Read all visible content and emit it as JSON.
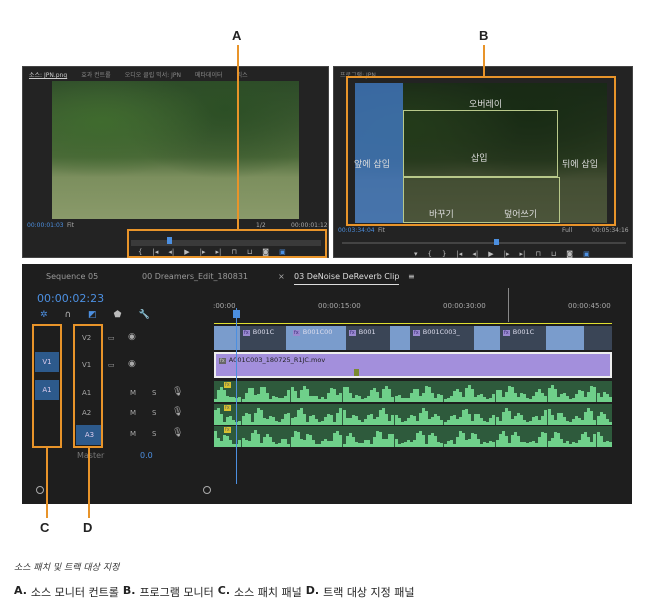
{
  "callouts": {
    "a": "A",
    "b": "B",
    "c": "C",
    "d": "D"
  },
  "source_monitor": {
    "tabs": [
      "소스: JPN.png",
      "효과 컨트롤",
      "오디오 클립 믹서: JPN",
      "메타데이터",
      "믹스"
    ],
    "timecode_left": "00:00:01:03",
    "fit": "Fit",
    "resolution": "1/2",
    "timecode_right": "00:00:01:12"
  },
  "program_monitor": {
    "tab": "프로그램: JPN",
    "overlays": {
      "overlay": "오버레이",
      "insert": "삽입",
      "insert_before": "앞에 삽입",
      "insert_after": "뒤에 삽입",
      "replace": "바꾸기",
      "overwrite": "덮어쓰기"
    },
    "timecode_left": "00:03:34:04",
    "fit": "Fit",
    "resolution": "Full",
    "timecode_right": "00:05:34:16"
  },
  "timeline": {
    "tabs": [
      "Sequence 05",
      "00 Dreamers_Edit_180831",
      "03 DeNoise DeReverb Clip"
    ],
    "active_tab_close": "×",
    "menu_icon": "≡",
    "timecode": "00:00:02:23",
    "ruler": [
      ":00:00",
      "00:00:15:00",
      "00:00:30:00",
      "00:00:45:00"
    ],
    "source_patch": {
      "v": "V1",
      "a": "A1"
    },
    "tracks": [
      {
        "label": "V2",
        "type": "video"
      },
      {
        "label": "V1",
        "type": "video"
      },
      {
        "label": "A1",
        "type": "audio",
        "m": "M",
        "s": "S"
      },
      {
        "label": "A2",
        "type": "audio",
        "m": "M",
        "s": "S"
      },
      {
        "label": "A3",
        "type": "audio",
        "m": "M",
        "s": "S"
      }
    ],
    "master": {
      "label": "Master",
      "value": "0.0"
    },
    "fx": "fx",
    "v2_clips": [
      "B001C",
      "B001C00",
      "B001",
      "B001C003_",
      "B001C"
    ],
    "v1_clip": "A001C003_180725_R1JC.mov"
  },
  "caption": {
    "title": "소스 패치 및 트랙 대상 지정",
    "legend": [
      {
        "key": "A.",
        "text": "소스 모니터 컨트롤"
      },
      {
        "key": "B.",
        "text": "프로그램 모니터"
      },
      {
        "key": "C.",
        "text": "소스 패치 패널"
      },
      {
        "key": "D.",
        "text": "트랙 대상 지정 패널"
      }
    ]
  }
}
